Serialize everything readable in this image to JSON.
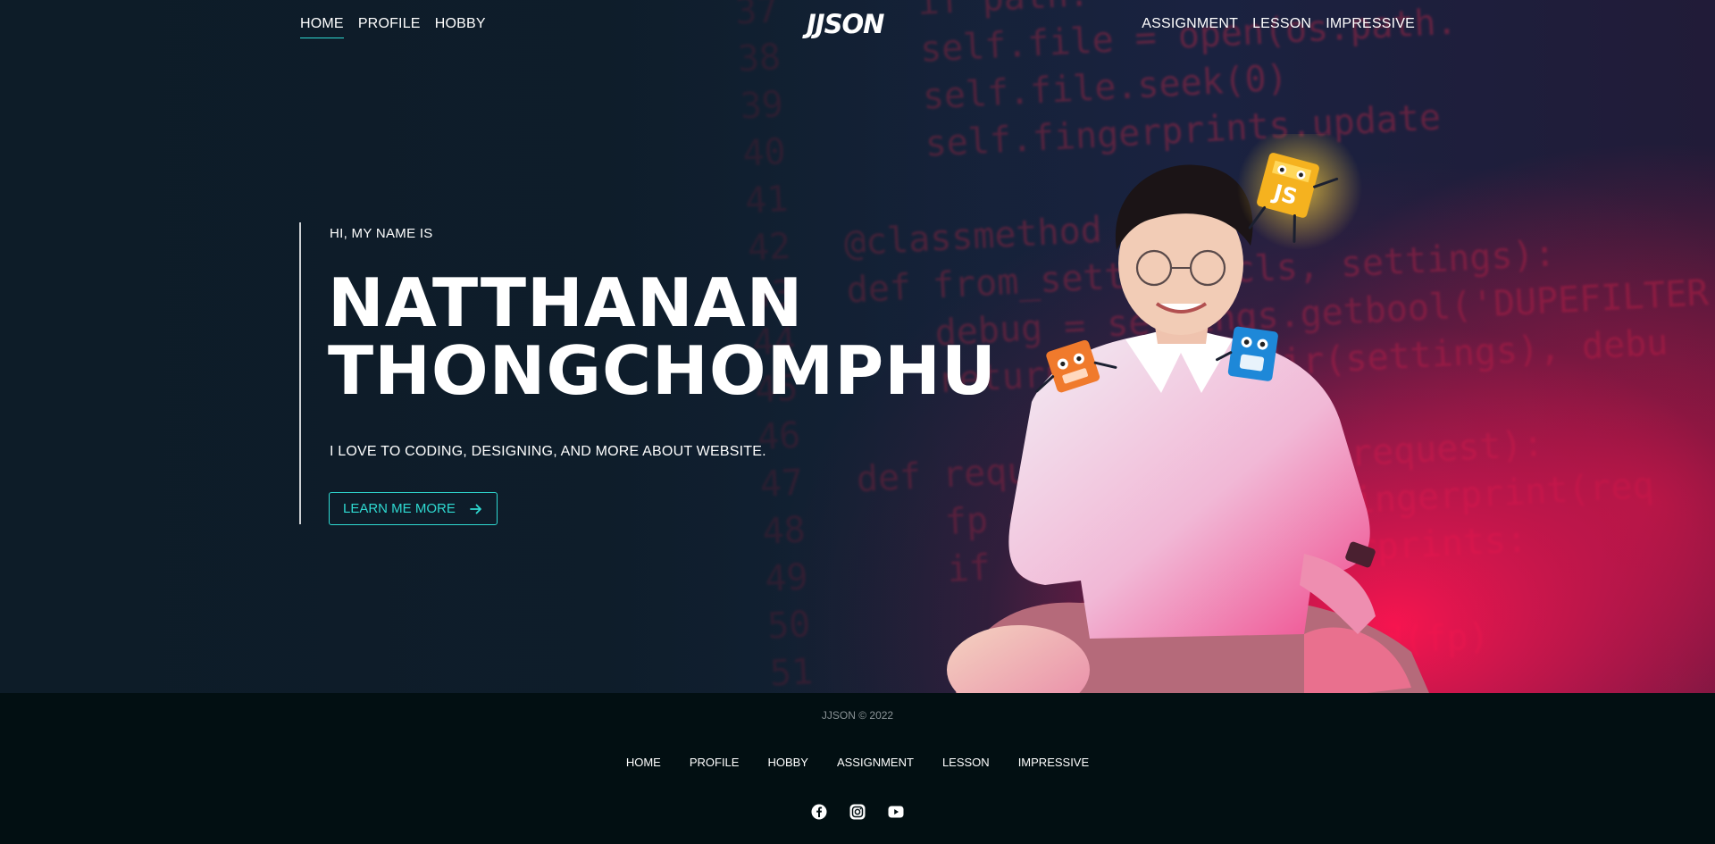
{
  "header": {
    "logo": "JJSON",
    "nav_left": [
      "HOME",
      "PROFILE",
      "HOBBY"
    ],
    "nav_right": [
      "ASSIGNMENT",
      "LESSON",
      "IMPRESSIVE"
    ],
    "active": "HOME"
  },
  "hero": {
    "greeting": "HI, MY NAME IS",
    "name_line1": "NATTHANAN",
    "name_line2": "THONGCHOMPHU",
    "tagline": "I LOVE TO CODING, DESIGNING, AND MORE ABOUT WEBSITE.",
    "cta_label": "LEARN ME MORE",
    "code_background": [
      {
        "num": "37",
        "code": "    if path:"
      },
      {
        "num": "38",
        "code": "    self.file = open(os.path."
      },
      {
        "num": "39",
        "code": "    self.file.seek(0)"
      },
      {
        "num": "40",
        "code": "    self.fingerprints.update"
      },
      {
        "num": "41",
        "code": ""
      },
      {
        "num": "42",
        "code": "@classmethod"
      },
      {
        "num": "43",
        "code": "def from_settings(cls, settings):"
      },
      {
        "num": "44",
        "code": "    debug = settings.getbool('DUPEFILTER"
      },
      {
        "num": "45",
        "code": "    return cls(job_dir(settings), debu"
      },
      {
        "num": "46",
        "code": ""
      },
      {
        "num": "47",
        "code": "def request_seen(self, request):"
      },
      {
        "num": "48",
        "code": "    fp = self.request_fingerprint(req"
      },
      {
        "num": "49",
        "code": "    if fp in self.fingerprints:"
      },
      {
        "num": "50",
        "code": "        return True"
      },
      {
        "num": "51",
        "code": "    self.fingerprints.add(fp)"
      }
    ]
  },
  "footer": {
    "copyright": "JJSON © 2022",
    "links": [
      "HOME",
      "PROFILE",
      "HOBBY",
      "ASSIGNMENT",
      "LESSON",
      "IMPRESSIVE"
    ],
    "socials": [
      "facebook-icon",
      "instagram-icon",
      "youtube-icon"
    ]
  },
  "colors": {
    "accent": "#2fd9d1",
    "hero_bg": "#15233a",
    "glow": "#ff1450",
    "footer_bg": "#020f12"
  }
}
